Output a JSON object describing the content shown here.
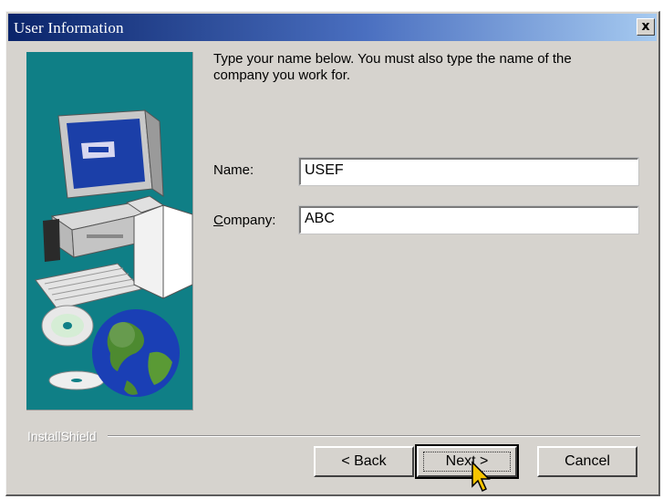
{
  "window": {
    "title": "User Information",
    "close_label": "x"
  },
  "instruction": "Type your name below. You must also type the name of the company you work for.",
  "fields": {
    "name_label": "Name:",
    "name_value": "USEF",
    "company_label_accel": "C",
    "company_label_rest": "ompany:",
    "company_value": "ABC"
  },
  "branding": "InstallShield",
  "buttons": {
    "back": "< Back",
    "next": "Next >",
    "cancel": "Cancel"
  },
  "icons": {
    "side_art": "computer-globe-cd-illustration",
    "cursor": "arrow-cursor-icon"
  },
  "colors": {
    "titlebar": "#0a246a",
    "panel": "#0f7f86",
    "window": "#d6d3ce"
  }
}
